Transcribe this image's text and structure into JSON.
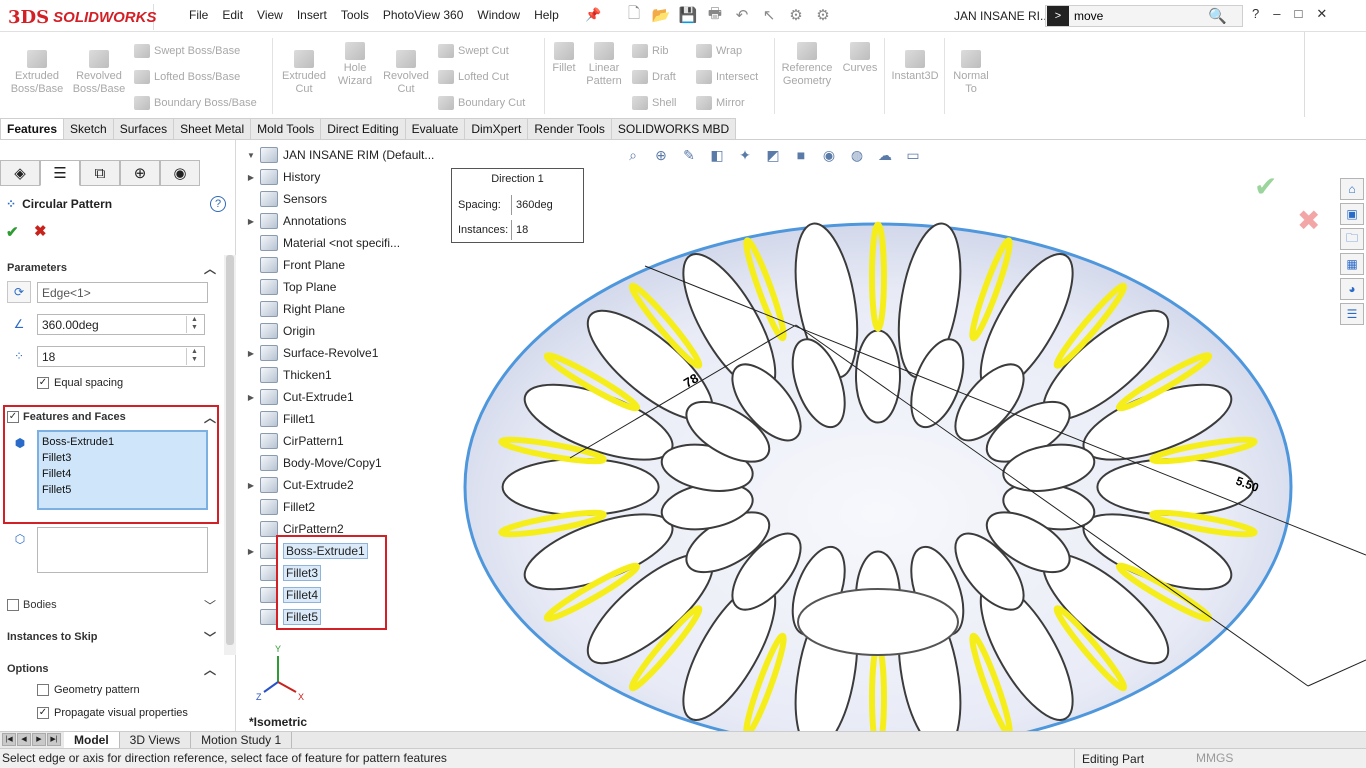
{
  "app": {
    "brand_mark": "3DS",
    "brand": "SOLIDWORKS",
    "document_title": "JAN INSANE RI..."
  },
  "menu": [
    "File",
    "Edit",
    "View",
    "Insert",
    "Tools",
    "PhotoView 360",
    "Window",
    "Help"
  ],
  "search": {
    "value": "move"
  },
  "window_controls": [
    "?",
    "–",
    "□",
    "✕"
  ],
  "command_manager": {
    "large": [
      {
        "label1": "Extruded",
        "label2": "Boss/Base"
      },
      {
        "label1": "Revolved",
        "label2": "Boss/Base"
      },
      {
        "label1": "Extruded",
        "label2": "Cut"
      },
      {
        "label1": "Hole",
        "label2": "Wizard"
      },
      {
        "label1": "Revolved",
        "label2": "Cut"
      },
      {
        "label1": "Fillet",
        "label2": ""
      },
      {
        "label1": "Linear",
        "label2": "Pattern"
      },
      {
        "label1": "Reference",
        "label2": "Geometry"
      },
      {
        "label1": "Curves",
        "label2": ""
      },
      {
        "label1": "Instant3D",
        "label2": ""
      },
      {
        "label1": "Normal",
        "label2": "To"
      }
    ],
    "small": [
      "Swept Boss/Base",
      "Lofted Boss/Base",
      "Boundary Boss/Base",
      "Swept Cut",
      "Lofted Cut",
      "Boundary Cut",
      "Rib",
      "Draft",
      "Shell",
      "Wrap",
      "Intersect",
      "Mirror"
    ]
  },
  "tabs": [
    "Features",
    "Sketch",
    "Surfaces",
    "Sheet Metal",
    "Mold Tools",
    "Direct Editing",
    "Evaluate",
    "DimXpert",
    "Render Tools",
    "SOLIDWORKS MBD"
  ],
  "property_manager": {
    "title": "Circular Pattern",
    "help": "?",
    "ok": "✔",
    "cancel": "✖",
    "parameters": {
      "header": "Parameters",
      "direction_ref": "Edge<1>",
      "angle": "360.00deg",
      "instances": "18",
      "equal_spacing": "Equal spacing"
    },
    "features_faces": {
      "header": "Features and Faces",
      "items": [
        "Boss-Extrude1",
        "Fillet3",
        "Fillet4",
        "Fillet5"
      ]
    },
    "sections": [
      "Bodies",
      "Instances to Skip",
      "Options"
    ],
    "options": [
      "Geometry pattern",
      "Propagate visual properties"
    ]
  },
  "tree": {
    "root": "JAN INSANE RIM  (Default...",
    "items": [
      "History",
      "Sensors",
      "Annotations",
      "Material <not specifi...",
      "Front Plane",
      "Top Plane",
      "Right Plane",
      "Origin",
      "Surface-Revolve1",
      "Thicken1",
      "Cut-Extrude1",
      "Fillet1",
      "CirPattern1",
      "Body-Move/Copy1",
      "Cut-Extrude2",
      "Fillet2",
      "CirPattern2",
      "Boss-Extrude1",
      "Fillet3",
      "Fillet4",
      "Fillet5"
    ]
  },
  "callout": {
    "title": "Direction 1",
    "spacing_label": "Spacing:",
    "spacing_value": "360deg",
    "instances_label": "Instances:",
    "instances_value": "18"
  },
  "dimensions": {
    "d1": "78",
    "d2": "5.50"
  },
  "view_label": "*Isometric",
  "bottom_tabs": [
    "Model",
    "3D Views",
    "Motion Study 1"
  ],
  "status": {
    "message": "Select edge or axis for direction reference, select face of feature for pattern features",
    "mode": "Editing Part",
    "units": "MMGS"
  }
}
